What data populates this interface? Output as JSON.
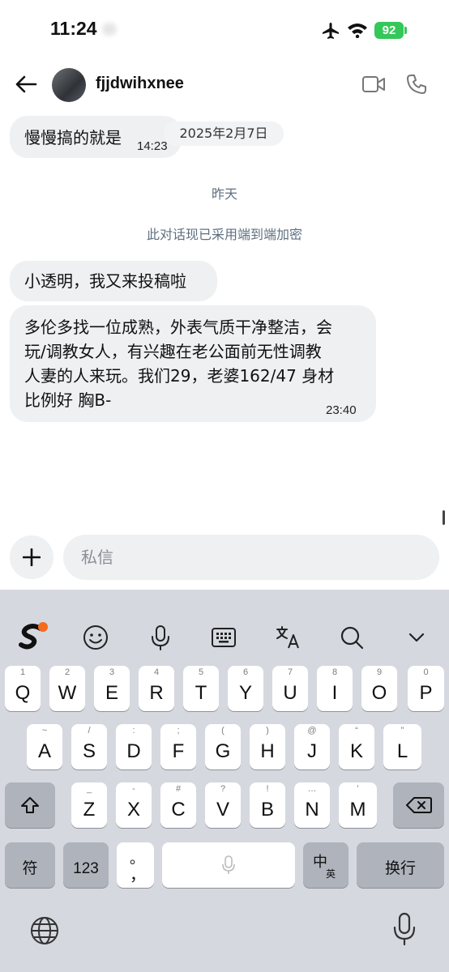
{
  "status_bar": {
    "time": "11:24",
    "battery": "92"
  },
  "header": {
    "contact_name": "fjjdwihxnee",
    "back_icon": "arrow-left-icon",
    "video_icon": "video-camera-icon",
    "call_icon": "phone-icon"
  },
  "messages": [
    {
      "text": "慢慢搞的就是",
      "time": "14:23"
    },
    {
      "text": "小透明，我又来投稿啦",
      "time": ""
    },
    {
      "lines": [
        "多伦多找一位成熟，外表气质干净整洁，会",
        "玩/调教女人，有兴趣在老公面前无性调教",
        "人妻的人来玩。我们29，老婆162/47 身材",
        "比例好 胸B-"
      ],
      "time": "23:40"
    }
  ],
  "date_divider": "2025年2月7日",
  "day_divider": "昨天",
  "encryption_notice": "此对话现已采用端到端加密",
  "composer": {
    "placeholder": "私信",
    "value": ""
  },
  "keyboard": {
    "toolbar": [
      "sogou-logo-icon",
      "emoji-icon",
      "microphone-icon",
      "keyboard-icon",
      "translate-icon",
      "search-icon",
      "chevron-down-icon"
    ],
    "row1": [
      {
        "main": "Q",
        "sub": "1"
      },
      {
        "main": "W",
        "sub": "2"
      },
      {
        "main": "E",
        "sub": "3"
      },
      {
        "main": "R",
        "sub": "4"
      },
      {
        "main": "T",
        "sub": "5"
      },
      {
        "main": "Y",
        "sub": "6"
      },
      {
        "main": "U",
        "sub": "7"
      },
      {
        "main": "I",
        "sub": "8"
      },
      {
        "main": "O",
        "sub": "9"
      },
      {
        "main": "P",
        "sub": "0"
      }
    ],
    "row2": [
      {
        "main": "A",
        "sub": "~"
      },
      {
        "main": "S",
        "sub": "/"
      },
      {
        "main": "D",
        "sub": ":"
      },
      {
        "main": "F",
        "sub": ";"
      },
      {
        "main": "G",
        "sub": "("
      },
      {
        "main": "H",
        "sub": ")"
      },
      {
        "main": "J",
        "sub": "@"
      },
      {
        "main": "K",
        "sub": "“"
      },
      {
        "main": "L",
        "sub": "”"
      }
    ],
    "row3": [
      {
        "main": "Z",
        "sub": "_"
      },
      {
        "main": "X",
        "sub": "-"
      },
      {
        "main": "C",
        "sub": "#"
      },
      {
        "main": "V",
        "sub": "?"
      },
      {
        "main": "B",
        "sub": "!"
      },
      {
        "main": "N",
        "sub": "…"
      },
      {
        "main": "M",
        "sub": "'"
      }
    ],
    "shift_icon": "shift-icon",
    "delete_icon": "backspace-icon",
    "symbol_key": "符",
    "num_key": "123",
    "punct_top": "。",
    "punct_bottom": "，",
    "lang_zh": "中",
    "lang_en": "英",
    "enter_key": "换行",
    "globe_icon": "globe-icon",
    "dictation_icon": "microphone-icon"
  }
}
